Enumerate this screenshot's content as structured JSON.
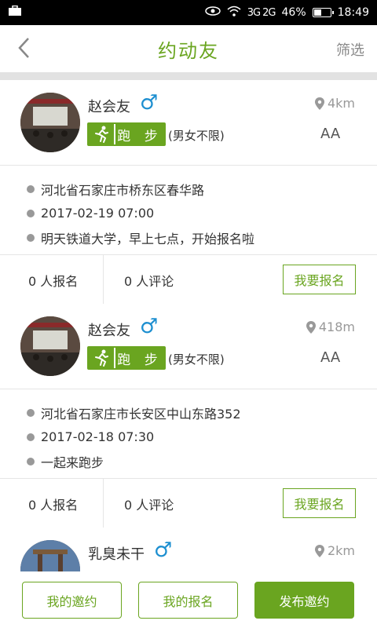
{
  "status_bar": {
    "signal_label": "3G 2G",
    "battery": "46%",
    "time": "18:49",
    "battery_level": 0.46
  },
  "header": {
    "title": "约动友",
    "filter_label": "筛选"
  },
  "posts": [
    {
      "name": "赵会友",
      "gender_symbol": "♂",
      "distance": "4km",
      "activity": "跑 步",
      "gender_limit": "(男女不限)",
      "fee": "AA",
      "address": "河北省石家庄市桥东区春华路",
      "datetime": "2017-02-19 07:00",
      "description": "明天铁道大学，早上七点，开始报名啦",
      "signup_count": "0 人报名",
      "comment_count": "0 人评论",
      "join_label": "我要报名"
    },
    {
      "name": "赵会友",
      "gender_symbol": "♂",
      "distance": "418m",
      "activity": "跑 步",
      "gender_limit": "(男女不限)",
      "fee": "AA",
      "address": "河北省石家庄市长安区中山东路352",
      "datetime": "2017-02-18 07:30",
      "description": "一起来跑步",
      "signup_count": "0 人报名",
      "comment_count": "0 人评论",
      "join_label": "我要报名"
    },
    {
      "name": "乳臭未干",
      "gender_symbol": "♂",
      "distance": "2km"
    }
  ],
  "bottom_bar": {
    "my_invites": "我的邀约",
    "my_signups": "我的报名",
    "publish": "发布邀约"
  },
  "colors": {
    "accent": "#6aa520",
    "male": "#1d8fd0"
  },
  "icons": [
    "briefcase-icon",
    "eye-icon",
    "wifi-icon",
    "back-arrow-icon",
    "location-pin-icon",
    "runner-icon",
    "male-icon"
  ]
}
